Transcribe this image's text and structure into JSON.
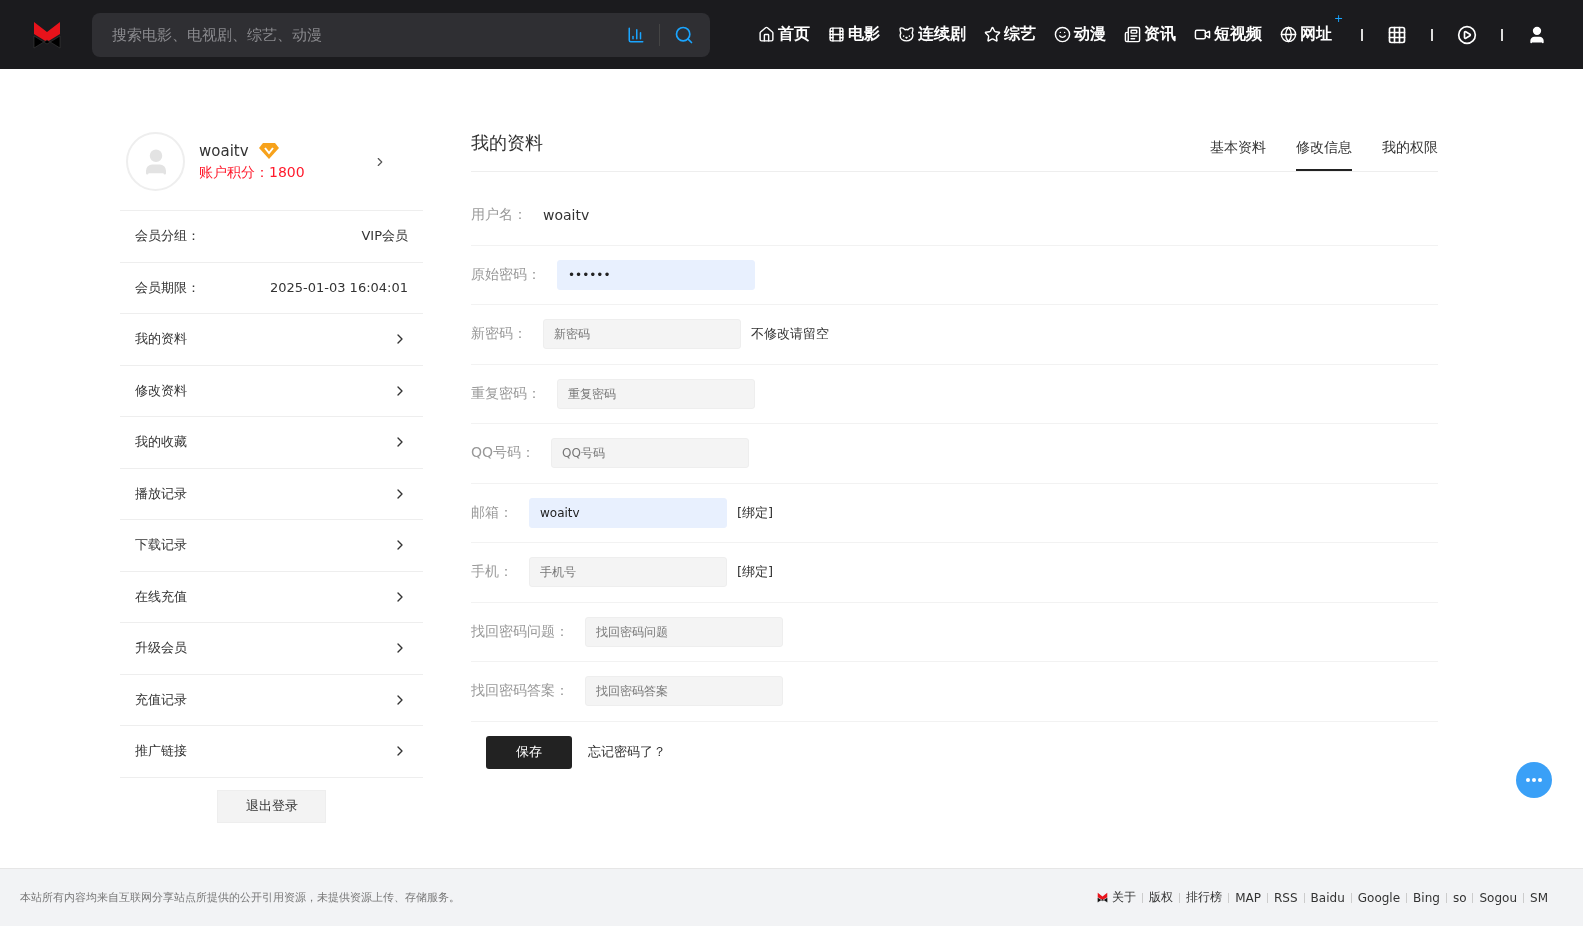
{
  "header": {
    "search": {
      "placeholder": "搜索电影、电视剧、综艺、动漫"
    },
    "nav": [
      {
        "label": "首页"
      },
      {
        "label": "电影"
      },
      {
        "label": "连续剧"
      },
      {
        "label": "综艺"
      },
      {
        "label": "动漫"
      },
      {
        "label": "资讯"
      },
      {
        "label": "短视频"
      },
      {
        "label": "网址",
        "badge": "+"
      }
    ]
  },
  "sidebar": {
    "username": "woaitv",
    "points": "账户积分：1800",
    "info": [
      {
        "label": "会员分组：",
        "value": "VIP会员"
      },
      {
        "label": "会员期限：",
        "value": "2025-01-03 16:04:01"
      }
    ],
    "menu": [
      "我的资料",
      "修改资料",
      "我的收藏",
      "播放记录",
      "下载记录",
      "在线充值",
      "升级会员",
      "充值记录",
      "推广链接"
    ],
    "logout": "退出登录"
  },
  "main": {
    "title": "我的资料",
    "tabs": [
      {
        "label": "基本资料",
        "selected": false
      },
      {
        "label": "修改信息",
        "selected": true
      },
      {
        "label": "我的权限",
        "selected": false
      }
    ],
    "rows": [
      {
        "kind": "text",
        "label": "用户名：",
        "value": "woaitv"
      },
      {
        "kind": "input",
        "label": "原始密码：",
        "value": "••••••",
        "autofilled": true
      },
      {
        "kind": "input",
        "label": "新密码：",
        "placeholder": "新密码",
        "autofilled": false,
        "note": "不修改请留空"
      },
      {
        "kind": "input",
        "label": "重复密码：",
        "placeholder": "重复密码",
        "autofilled": false
      },
      {
        "kind": "input",
        "label": "QQ号码：",
        "placeholder": "QQ号码",
        "autofilled": false
      },
      {
        "kind": "input",
        "label": "邮箱：",
        "value": "woaitv",
        "autofilled": true,
        "note": "[绑定]"
      },
      {
        "kind": "input",
        "label": "手机：",
        "placeholder": "手机号",
        "autofilled": false,
        "note": "[绑定]"
      },
      {
        "kind": "input",
        "label": "找回密码问题：",
        "placeholder": "找回密码问题",
        "autofilled": false
      },
      {
        "kind": "input",
        "label": "找回密码答案：",
        "placeholder": "找回密码答案",
        "autofilled": false
      }
    ],
    "save": "保存",
    "forgot": "忘记密码了？"
  },
  "footer": {
    "notice": "本站所有内容均来自互联网分享站点所提供的公开引用资源，未提供资源上传、存储服务。",
    "links": [
      "关于",
      "版权",
      "排行榜",
      "MAP",
      "RSS",
      "Baidu",
      "Google",
      "Bing",
      "so",
      "Sogou",
      "SM"
    ]
  }
}
